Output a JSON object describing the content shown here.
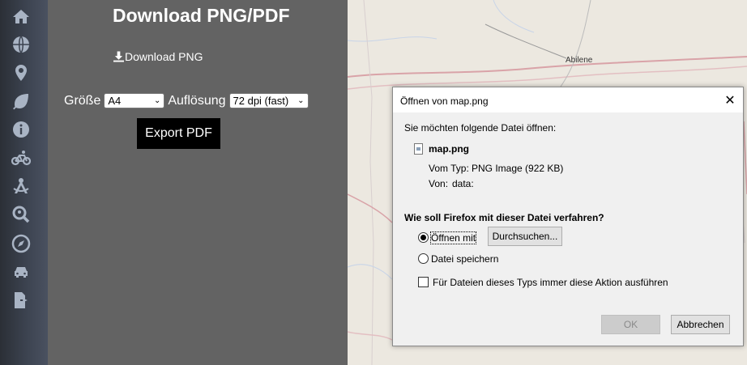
{
  "sidebar": {
    "icons": [
      "home-icon",
      "globe-icon",
      "map-marker-icon",
      "leaf-icon",
      "info-icon",
      "bicycle-icon",
      "drafting-compass-icon",
      "search-location-icon",
      "compass-icon",
      "car-icon",
      "file-export-icon"
    ]
  },
  "panel": {
    "title": "Download PNG/PDF",
    "download_png": "Download PNG",
    "size_label": "Größe",
    "size_value": "A4",
    "resolution_label": "Auflösung",
    "resolution_value": "72 dpi (fast)",
    "export_button": "Export PDF"
  },
  "map": {
    "city_label": "Abilene"
  },
  "dialog": {
    "title": "Öffnen von map.png",
    "intro": "Sie möchten folgende Datei öffnen:",
    "file_name": "map.png",
    "type_label": "Vom Typ:",
    "type_value": "PNG Image (922 KB)",
    "from_label": "Von:",
    "from_value": "data:",
    "question": "Wie soll Firefox mit dieser Datei verfahren?",
    "open_with_label": "Öffnen mit",
    "browse_button": "Durchsuchen...",
    "save_label": "Datei speichern",
    "always_label": "Für Dateien dieses Typs immer diese Aktion ausführen",
    "ok_button": "OK",
    "cancel_button": "Abbrechen",
    "open_with_selected": true,
    "always_checked": false
  }
}
